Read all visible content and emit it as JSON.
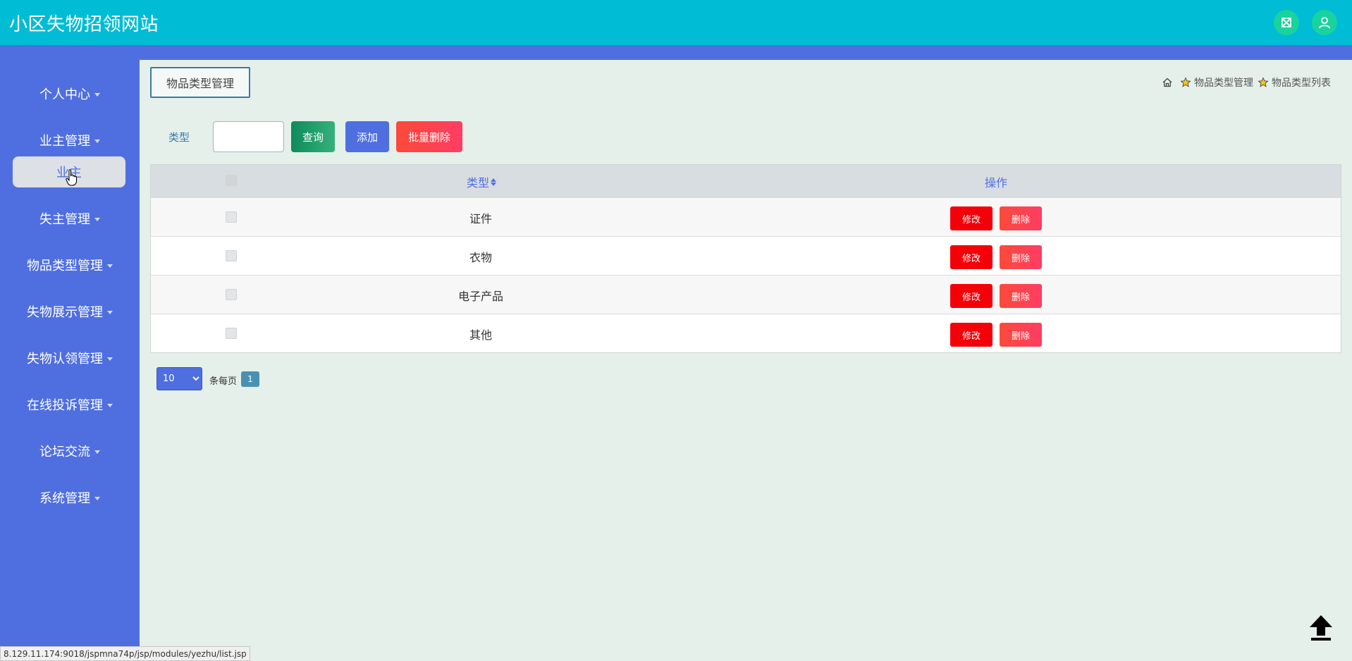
{
  "app": {
    "title": "小区失物招领网站"
  },
  "header": {
    "fullscreen_icon": "expand-arrows-icon",
    "user_icon": "user-icon",
    "accent_color": "#00bcd4",
    "button_color": "#19d39e"
  },
  "sidebar": {
    "background": "#4f6fe0",
    "items": [
      {
        "label": "个人中心"
      },
      {
        "label": "业主管理"
      },
      {
        "label": "失主管理"
      },
      {
        "label": "物品类型管理"
      },
      {
        "label": "失物展示管理"
      },
      {
        "label": "失物认领管理"
      },
      {
        "label": "在线投诉管理"
      },
      {
        "label": "论坛交流"
      },
      {
        "label": "系统管理"
      }
    ],
    "active_sub_item": "业主"
  },
  "page": {
    "section_title": "物品类型管理",
    "breadcrumb": [
      "物品类型管理",
      "物品类型列表"
    ]
  },
  "search": {
    "label": "类型",
    "value": "",
    "placeholder": "",
    "search_button": "查询",
    "add_button": "添加",
    "batch_delete_button": "批量删除"
  },
  "table": {
    "columns": [
      "类型",
      "操作"
    ],
    "rows": [
      {
        "type": "证件"
      },
      {
        "type": "衣物"
      },
      {
        "type": "电子产品"
      },
      {
        "type": "其他"
      }
    ],
    "edit_label": "修改",
    "delete_label": "删除"
  },
  "pagination": {
    "page_size": "10",
    "page_size_label": "条每页",
    "current_page": "1"
  },
  "statusbar": {
    "url": "8.129.11.174:9018/jspmna74p/jsp/modules/yezhu/list.jsp"
  }
}
